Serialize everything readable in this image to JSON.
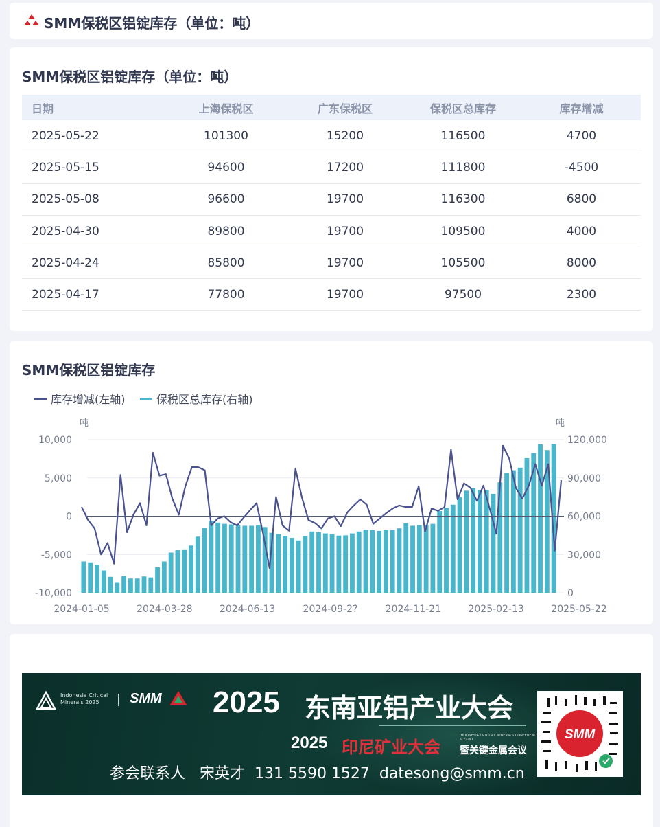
{
  "header": {
    "title": "SMM保税区铝锭库存（单位：吨）"
  },
  "table_card": {
    "title": "SMM保税区铝锭库存（单位：吨）",
    "columns": [
      "日期",
      "上海保税区",
      "广东保税区",
      "保税区总库存",
      "库存增减"
    ],
    "rows": [
      [
        "2025-05-22",
        "101300",
        "15200",
        "116500",
        "4700"
      ],
      [
        "2025-05-15",
        "94600",
        "17200",
        "111800",
        "-4500"
      ],
      [
        "2025-05-08",
        "96600",
        "19700",
        "116300",
        "6800"
      ],
      [
        "2025-04-30",
        "89800",
        "19700",
        "109500",
        "4000"
      ],
      [
        "2025-04-24",
        "85800",
        "19700",
        "105500",
        "8000"
      ],
      [
        "2025-04-17",
        "77800",
        "19700",
        "97500",
        "2300"
      ]
    ]
  },
  "chart_card": {
    "title": "SMM保税区铝锭库存"
  },
  "chart_data": {
    "type": "bar",
    "title": "SMM保税区铝锭库存",
    "legend_position": "top-left",
    "left_axis": {
      "unit": "吨",
      "ticks": [
        "10,000",
        "5,000",
        "0",
        "-5,000",
        "-10,000"
      ],
      "range": [
        -10000,
        10000
      ]
    },
    "right_axis": {
      "unit": "吨",
      "ticks": [
        "120,000",
        "90,000",
        "60,000",
        "30,000",
        "0"
      ],
      "range": [
        0,
        120000
      ]
    },
    "x_tick_labels": [
      "2024-01-05",
      "2024-03-28",
      "2024-06-13",
      "2024-09-2?",
      "2024-11-21",
      "2025-02-13",
      "2025-05-22"
    ],
    "series": [
      {
        "name": "库存增减(左轴)",
        "kind": "line",
        "axis": "left",
        "color": "#4a5390",
        "values": [
          1200,
          -500,
          -1600,
          -5000,
          -3500,
          -6200,
          5400,
          -2100,
          200,
          1700,
          -1200,
          8300,
          5300,
          5500,
          2300,
          200,
          3900,
          6400,
          6400,
          6000,
          -1200,
          -300,
          0,
          -800,
          -1200,
          -200,
          800,
          1700,
          -2300,
          -6800,
          2500,
          -1200,
          -1900,
          6200,
          2400,
          -500,
          -900,
          -1600,
          -300,
          0,
          -1300,
          500,
          1400,
          2200,
          1500,
          -1000,
          -300,
          400,
          1000,
          1400,
          1200,
          1200,
          3900,
          -2000,
          1000,
          700,
          1200,
          8700,
          2200,
          4300,
          3700,
          2000,
          4000,
          900,
          -2300,
          9200,
          7500,
          3700,
          2300,
          4000,
          6800,
          4000,
          6800,
          -4500,
          4700
        ]
      },
      {
        "name": "保税区总库存(右轴)",
        "kind": "bar",
        "axis": "right",
        "color": "#4ab6cb",
        "values": [
          24500,
          23800,
          22000,
          17500,
          12500,
          7800,
          13000,
          11200,
          11200,
          12800,
          12000,
          20000,
          24500,
          31500,
          33500,
          34000,
          37000,
          44000,
          51000,
          56500,
          55000,
          54000,
          53500,
          53000,
          52500,
          52500,
          53000,
          51500,
          47000,
          46000,
          44500,
          43000,
          41000,
          44500,
          48000,
          47500,
          46500,
          46000,
          44800,
          45000,
          46500,
          48000,
          49500,
          49000,
          48500,
          49000,
          49500,
          50500,
          54500,
          52500,
          53000,
          53000,
          54000,
          64000,
          66500,
          69000,
          75000,
          80000,
          82000,
          80500,
          80500,
          77500,
          86500,
          94000,
          96000,
          98000,
          105500,
          109500,
          116300,
          111800,
          116500
        ]
      }
    ]
  },
  "banner": {
    "brand_logo_text": "Indonesia Critical Minerals 2025",
    "smm_logo_text": "SMM",
    "headline_year": "2025",
    "headline": "东南亚铝产业大会",
    "sub_year": "2025",
    "sub_red": "印尼矿业大会",
    "sub_white": "暨关键金属会议",
    "sub_small": "INDONESIA CRITICAL MINERALS CONFERENCE & EXPO",
    "contact": "参会联系人   宋英才  131 5590 1527  datesong@smm.cn",
    "qr_label": "SMM"
  }
}
